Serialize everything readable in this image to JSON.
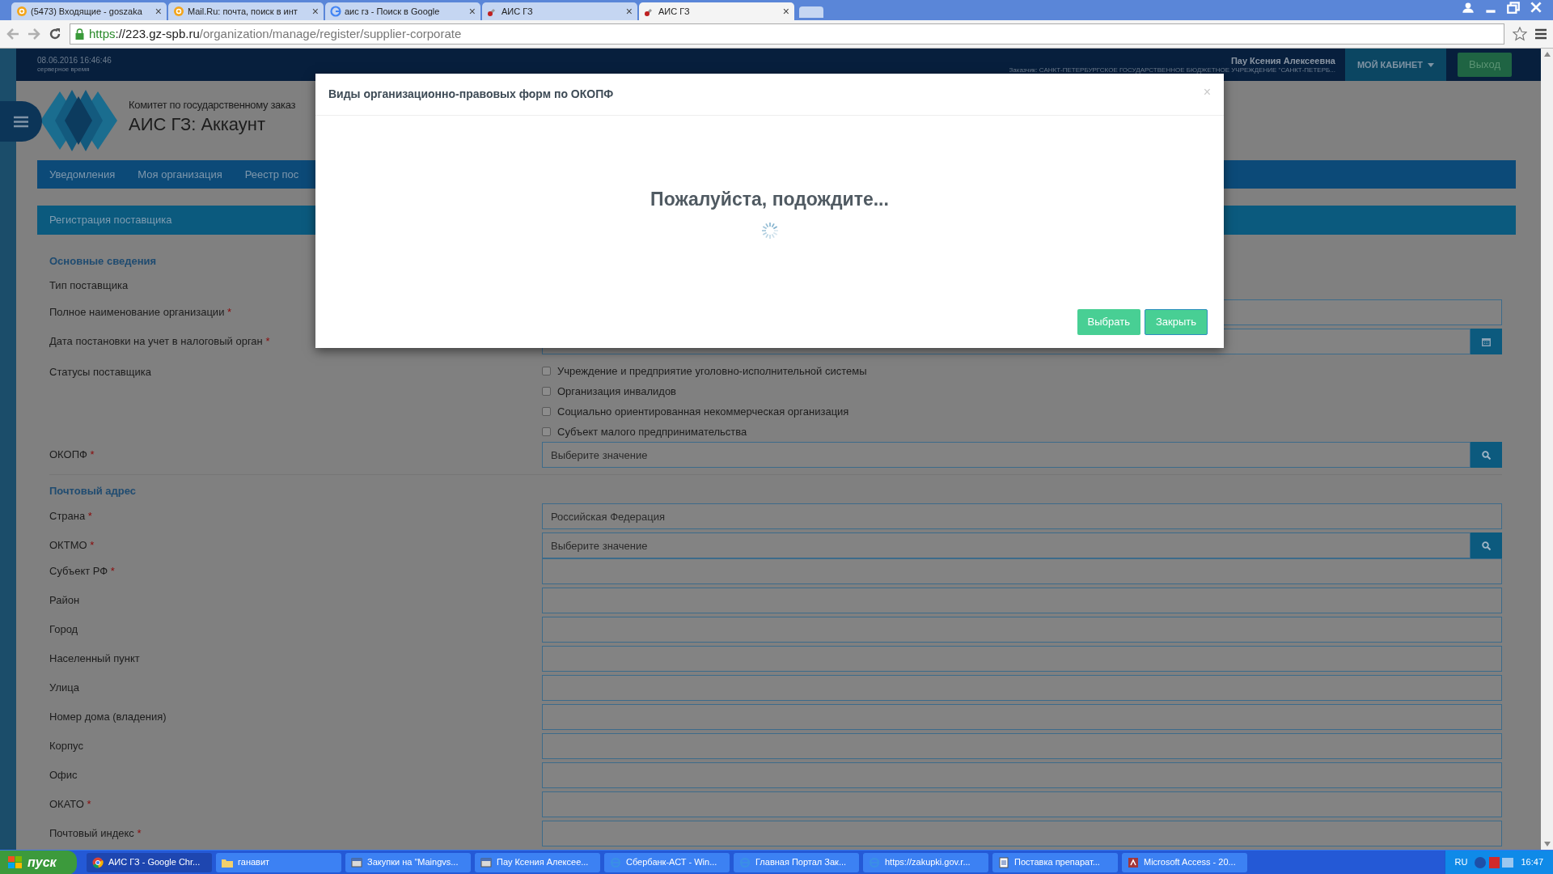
{
  "browser": {
    "tabs": [
      {
        "title": "(5473) Входящие - goszaka",
        "close": "×",
        "selected": false
      },
      {
        "title": "Mail.Ru: почта, поиск в инт",
        "close": "×",
        "selected": false
      },
      {
        "title": "аис гз - Поиск в Google",
        "close": "×",
        "selected": false
      },
      {
        "title": "АИС ГЗ",
        "close": "×",
        "selected": false
      },
      {
        "title": "АИС ГЗ",
        "close": "×",
        "selected": true
      }
    ],
    "url_parts": [
      "https",
      "://223.gz-spb.ru",
      "/organization/manage/register/supplier-corporate"
    ]
  },
  "header": {
    "datetime": "08.06.2016 16:46:46",
    "datetime_note": "серверное время",
    "user": "Пау Ксения Алексеевна",
    "org": "Заказчик: САНКТ-ПЕТЕРБУРГСКОЕ ГОСУДАРСТВЕННОЕ БЮДЖЕТНОЕ УЧРЕЖДЕНИЕ \"САНКТ-ПЕТЕРБ...",
    "cabinet": "МОЙ КАБИНЕТ",
    "logout": "Выход"
  },
  "logo": {
    "subtitle": "Комитет по государственному заказ",
    "title": "АИС ГЗ: Аккаунт"
  },
  "nav": [
    "Уведомления",
    "Моя организация",
    "Реестр пос"
  ],
  "panel_title": "Регистрация поставщика",
  "form": [
    {
      "kind": "heading",
      "label": "Основные сведения"
    },
    {
      "kind": "label",
      "label": "Тип поставщика"
    },
    {
      "kind": "input",
      "label": "Полное наименование организации",
      "required_mark": "*"
    },
    {
      "kind": "date",
      "label": "Дата постановки на учет в налоговый орган",
      "required_mark": "*"
    },
    {
      "kind": "checks",
      "label": "Статусы поставщика",
      "options": [
        {
          "label": "Учреждение и предприятие уголовно-исполнительной системы",
          "checked": false
        },
        {
          "label": "Организация инвалидов",
          "checked": false
        },
        {
          "label": "Социально ориентированная некоммерческая организация",
          "checked": false
        },
        {
          "label": "Субъект малого предпринимательства",
          "checked": false
        }
      ]
    },
    {
      "kind": "lookup",
      "label": "ОКОПФ",
      "required_mark": "*",
      "placeholder": "Выберите значение"
    },
    {
      "kind": "divider"
    },
    {
      "kind": "heading",
      "label": "Почтовый адрес"
    },
    {
      "kind": "input",
      "label": "Страна",
      "required_mark": "*",
      "value": "Российская Федерация"
    },
    {
      "kind": "lookup",
      "label": "ОКТМО",
      "required_mark": "*",
      "placeholder": "Выберите значение"
    },
    {
      "kind": "input",
      "label": "Субъект РФ",
      "required_mark": "*"
    },
    {
      "kind": "input",
      "label": "Район"
    },
    {
      "kind": "input",
      "label": "Город"
    },
    {
      "kind": "input",
      "label": "Населенный пункт"
    },
    {
      "kind": "input",
      "label": "Улица"
    },
    {
      "kind": "input",
      "label": "Номер дома (владения)"
    },
    {
      "kind": "input",
      "label": "Корпус"
    },
    {
      "kind": "input",
      "label": "Офис"
    },
    {
      "kind": "input",
      "label": "ОКАТО",
      "required_mark": "*"
    },
    {
      "kind": "input",
      "label": "Почтовый индекс",
      "required_mark": "*"
    }
  ],
  "modal": {
    "title": "Виды организационно-правовых форм по ОКОПФ",
    "close": "×",
    "message": "Пожалуйста, подождите...",
    "buttons": [
      "Выбрать",
      "Закрыть"
    ]
  },
  "taskbar": {
    "start": "пуск",
    "items": [
      {
        "label": "АИС ГЗ - Google Chr...",
        "selected": true
      },
      {
        "label": "ганавит",
        "selected": false
      },
      {
        "label": "Закупки на \"Maingvs...",
        "selected": false
      },
      {
        "label": "Пау Ксения Алексее...",
        "selected": false
      },
      {
        "label": "Сбербанк-АСТ - Win...",
        "selected": false
      },
      {
        "label": "Главная Портал Зак...",
        "selected": false
      },
      {
        "label": "https://zakupki.gov.r...",
        "selected": false
      },
      {
        "label": "Поставка препарат...",
        "selected": false
      },
      {
        "label": "Microsoft Access - 20...",
        "selected": false
      }
    ],
    "lang": "RU",
    "clock": "16:47"
  }
}
